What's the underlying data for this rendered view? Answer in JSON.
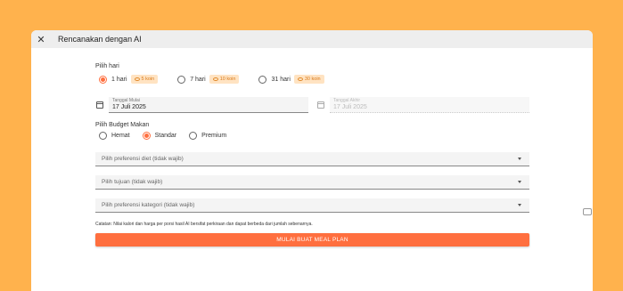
{
  "dialog": {
    "title": "Rencanakan dengan AI",
    "close_icon": "close-icon"
  },
  "days": {
    "label": "Pilih hari",
    "options": [
      {
        "label": "1 hari",
        "coin": "5 koin",
        "selected": true
      },
      {
        "label": "7 hari",
        "coin": "10 koin",
        "selected": false
      },
      {
        "label": "31 hari",
        "coin": "30 koin",
        "selected": false
      }
    ]
  },
  "dates": {
    "start_label": "Tanggal Mulai",
    "start_value": "17 Juli 2025",
    "end_label": "Tanggal Akhir",
    "end_value": "17 Juli 2025"
  },
  "budget": {
    "label": "Pilih Budget Makan",
    "options": [
      {
        "label": "Hemat",
        "selected": false
      },
      {
        "label": "Standar",
        "selected": true
      },
      {
        "label": "Premium",
        "selected": false
      }
    ]
  },
  "selects": {
    "diet": "Pilih preferensi diet (tidak wajib)",
    "goal": "Pilih tujuan (tidak wajib)",
    "category": "Pilih preferensi kategori (tidak wajib)"
  },
  "note": "Catatan: Nilai kalori dan harga per porsi hasil AI bersifat perkiraan dan dapat berbeda dari jumlah sebenarnya.",
  "cta": "MULAI BUAT MEAL PLAN",
  "colors": {
    "accent": "#ff6f3f",
    "background": "#ffb24d",
    "coin_bg": "#ffe3c2"
  }
}
